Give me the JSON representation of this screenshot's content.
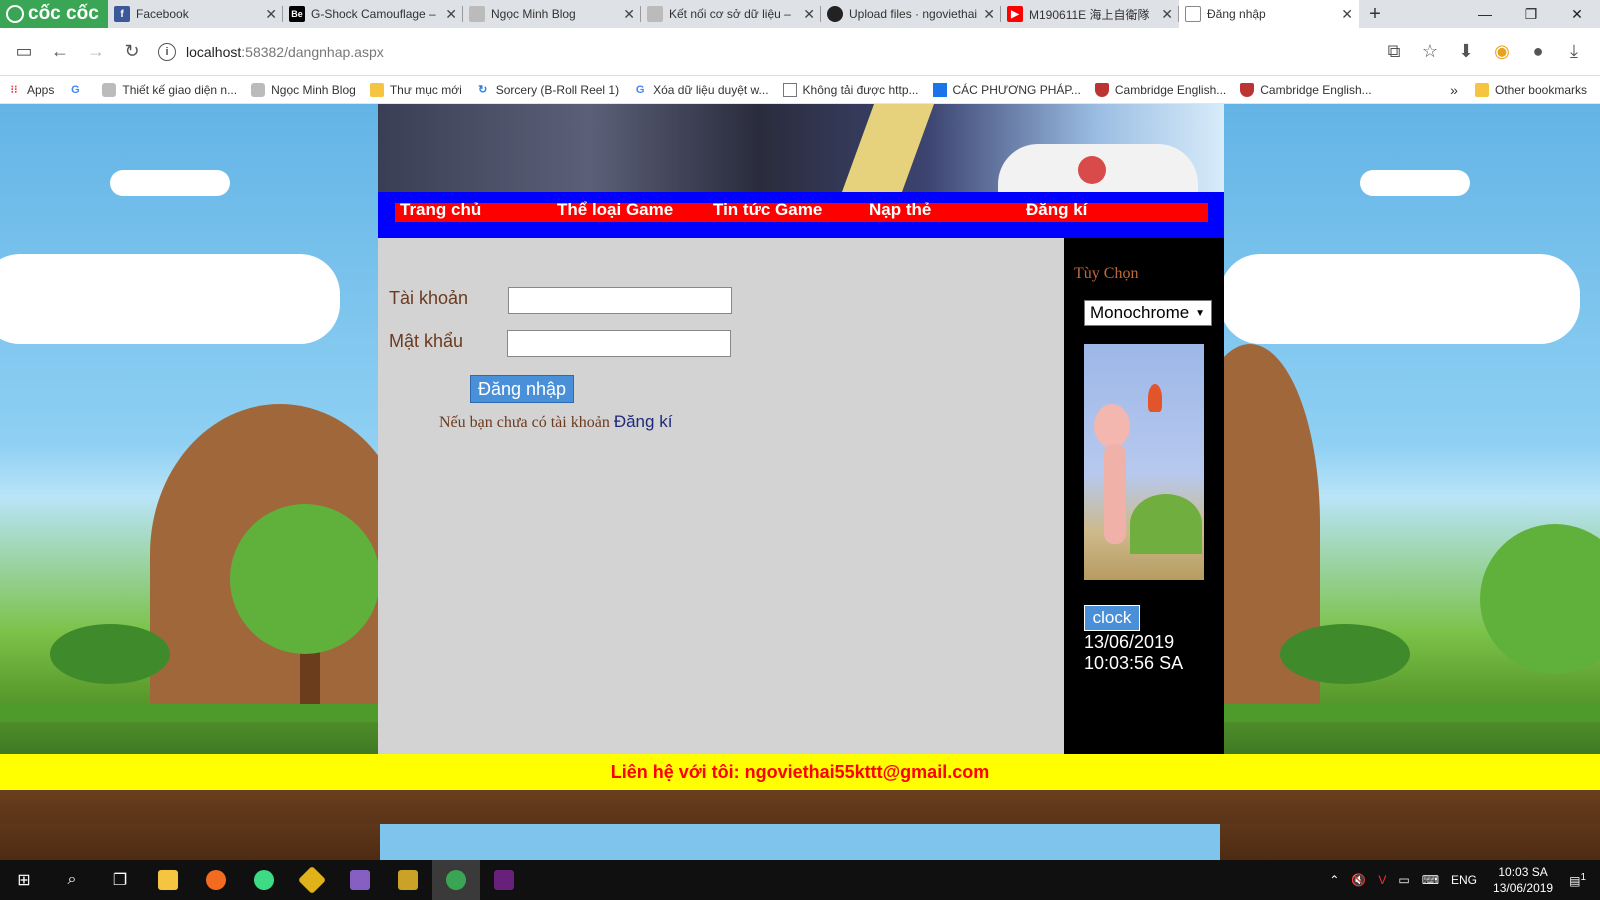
{
  "browser": {
    "brand": "cốc cốc",
    "tabs": [
      {
        "label": "Facebook",
        "icon": "facebook-icon",
        "color": "#3b5998"
      },
      {
        "label": "G-Shock Camouflage –",
        "icon": "behance-icon",
        "color": "#1769ff"
      },
      {
        "label": "Ngọc Minh Blog",
        "icon": "blog-avatar-icon",
        "color": "#777777"
      },
      {
        "label": "Kết nối cơ sở dữ liệu –",
        "icon": "blog-avatar-icon",
        "color": "#777777"
      },
      {
        "label": "Upload files · ngoviethai",
        "icon": "github-icon",
        "color": "#222222"
      },
      {
        "label": "M190611E 海上自衛隊",
        "icon": "youtube-icon",
        "color": "#ff0000"
      },
      {
        "label": "Đăng nhập",
        "icon": "page-icon",
        "color": "#888888"
      }
    ],
    "url_host": "localhost",
    "url_rest": ":58382/dangnhap.aspx",
    "bookmarks": [
      {
        "label": "Apps",
        "icon": "apps-icon"
      },
      {
        "label": "",
        "icon": "google-icon"
      },
      {
        "label": "Thiết kế giao diện n...",
        "icon": "blog-avatar-icon"
      },
      {
        "label": "Ngọc Minh Blog",
        "icon": "blog-avatar-icon"
      },
      {
        "label": "Thư mục mới",
        "icon": "folder-icon"
      },
      {
        "label": "Sorcery (B-Roll Reel 1)",
        "icon": "refresh-circle-icon"
      },
      {
        "label": "Xóa dữ liệu duyệt w...",
        "icon": "google-icon"
      },
      {
        "label": "Không tải được http...",
        "icon": "page-icon"
      },
      {
        "label": "CÁC PHƯƠNG PHÁP...",
        "icon": "square-blue-icon"
      },
      {
        "label": "Cambridge English...",
        "icon": "shield-icon"
      },
      {
        "label": "Cambridge English...",
        "icon": "shield-icon"
      }
    ],
    "other_bookmarks": "Other bookmarks"
  },
  "site": {
    "nav": [
      "Trang chủ",
      "Thể loại Game",
      "Tin tức Game",
      "Nạp thẻ",
      "Đăng kí"
    ],
    "form": {
      "username_label": "Tài khoản",
      "username_value": "",
      "password_label": "Mật khẩu",
      "password_value": "",
      "submit_label": "Đăng nhập",
      "note_text": "Nếu bạn chưa có tài khoản",
      "register_link": "Đăng kí"
    },
    "sidebar": {
      "title": "Tùy Chọn",
      "theme_selected": "Monochrome",
      "clock_button": "clock",
      "date": "13/06/2019",
      "time": "10:03:56 SA"
    },
    "footer": "Liên hệ với tôi: ngoviethai55kttt@gmail.com"
  },
  "taskbar": {
    "lang": "ENG",
    "time": "10:03 SA",
    "date": "13/06/2019",
    "notifications": "1"
  },
  "colors": {
    "nav_blue": "#0000ff",
    "nav_red": "#ff0000",
    "footer_yellow": "#ffff00",
    "button_blue": "#4a90d9"
  }
}
